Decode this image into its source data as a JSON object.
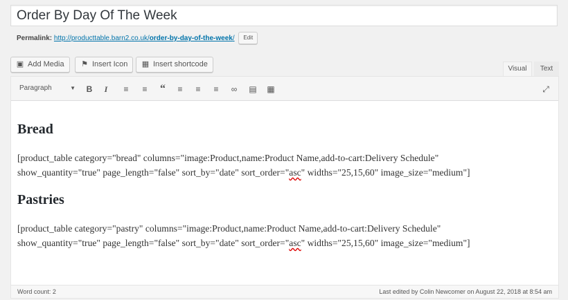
{
  "post": {
    "title": "Order By Day Of The Week",
    "permalink_label": "Permalink:",
    "permalink_base": "http://producttable.barn2.co.uk/",
    "permalink_slug": "order-by-day-of-the-week",
    "permalink_end": "/",
    "edit_label": "Edit"
  },
  "media_buttons": {
    "add_media": "Add Media",
    "insert_icon": "Insert Icon",
    "insert_shortcode": "Insert shortcode"
  },
  "tabs": {
    "visual": "Visual",
    "text": "Text"
  },
  "toolbar": {
    "format": "Paragraph",
    "icons": [
      "bold-icon",
      "italic-icon",
      "bullet-list-icon",
      "numbered-list-icon",
      "blockquote-icon",
      "align-left-icon",
      "align-center-icon",
      "align-right-icon",
      "link-icon",
      "read-more-icon",
      "toolbar-toggle-icon",
      "fullscreen-icon"
    ]
  },
  "content": {
    "heading_bread": "Bread",
    "shortcode_bread": {
      "line1": "[product_table category=\"bread\" columns=\"image:Product,name:Product Name,add-to-cart:Delivery Schedule\"",
      "line2_a": "show_quantity=\"true\" page_length=\"false\" sort_by=\"date\" sort_order=\"",
      "line2_asc": "asc",
      "line2_b": "\" widths=\"25,15,60\" image_size=\"medium\"]"
    },
    "heading_pastries": "Pastries",
    "shortcode_pastries": {
      "line1": "[product_table category=\"pastry\" columns=\"image:Product,name:Product Name,add-to-cart:Delivery Schedule\"",
      "line2_a": "show_quantity=\"true\" page_length=\"false\" sort_by=\"date\" sort_order=\"",
      "line2_asc": "asc",
      "line2_b": "\" widths=\"25,15,60\" image_size=\"medium\"]"
    }
  },
  "status": {
    "word_count": "Word count: 2",
    "last_edited": "Last edited by Colin Newcomer on August 22, 2018 at 8:54 am"
  }
}
